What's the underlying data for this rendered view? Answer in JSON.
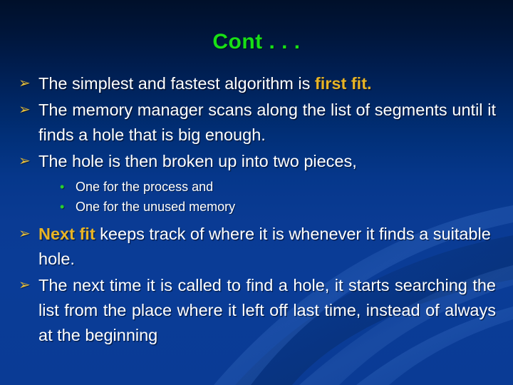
{
  "slide": {
    "title": "Cont . . .",
    "title_color": "#18e016",
    "background_top_color": "#00102a",
    "background_bottom_color": "#0a3b95",
    "text_color": "#ffffff",
    "highlight_color": "#e8b425",
    "level1_marker_glyph": "➢",
    "level1_marker_color": "#e3bc3c",
    "level2_marker_glyph": "•",
    "level2_marker_color": "#2ad02a"
  },
  "bullets": {
    "b1_pre": "The simplest and fastest algorithm is ",
    "b1_hl": "first fit.",
    "b2": "The memory manager scans along the list of segments until it finds a hole that is big enough.",
    "b3": "The hole is then broken up into two pieces,",
    "sub1": "One for the process and",
    "sub2": "One for the unused memory",
    "b4_hl": "Next fit",
    "b4_post": " keeps track of where it is whenever it finds a suitable hole.",
    "b5": "The next time it is called to find a hole, it starts searching the list from the place where it left off last time, instead of always at the beginning"
  }
}
